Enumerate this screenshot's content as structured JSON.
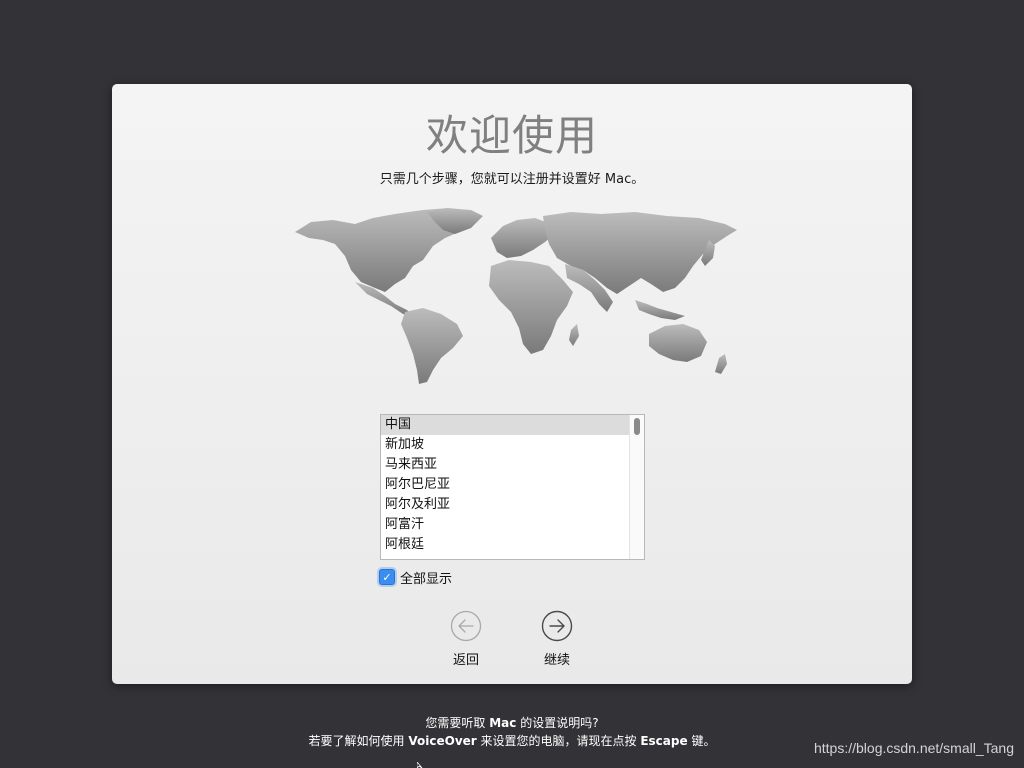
{
  "setup": {
    "title": "欢迎使用",
    "subtitle": "只需几个步骤，您就可以注册并设置好 Mac。"
  },
  "country_list": {
    "selected_index": 0,
    "items": [
      "中国",
      "新加坡",
      "马来西亚",
      "阿尔巴尼亚",
      "阿尔及利亚",
      "阿富汗",
      "阿根廷"
    ]
  },
  "show_all": {
    "label": "全部显示",
    "checked": true
  },
  "nav": {
    "back_label": "返回",
    "continue_label": "继续"
  },
  "footer": {
    "line1_prefix": "您需要听取 ",
    "line1_bold": "Mac",
    "line1_suffix": " 的设置说明吗?",
    "line2_prefix": "若要了解如何使用 ",
    "line2_bold1": "VoiceOver",
    "line2_mid": " 来设置您的电脑，请现在点按 ",
    "line2_bold2": "Escape",
    "line2_suffix": " 键。"
  },
  "watermark": "https://blog.csdn.net/small_Tang",
  "colors": {
    "background": "#333337",
    "accent": "#3b8ef0"
  },
  "icons": [
    "world-map",
    "checkmark-icon",
    "arrow-left-circle-icon",
    "arrow-right-circle-icon",
    "mouse-cursor"
  ]
}
